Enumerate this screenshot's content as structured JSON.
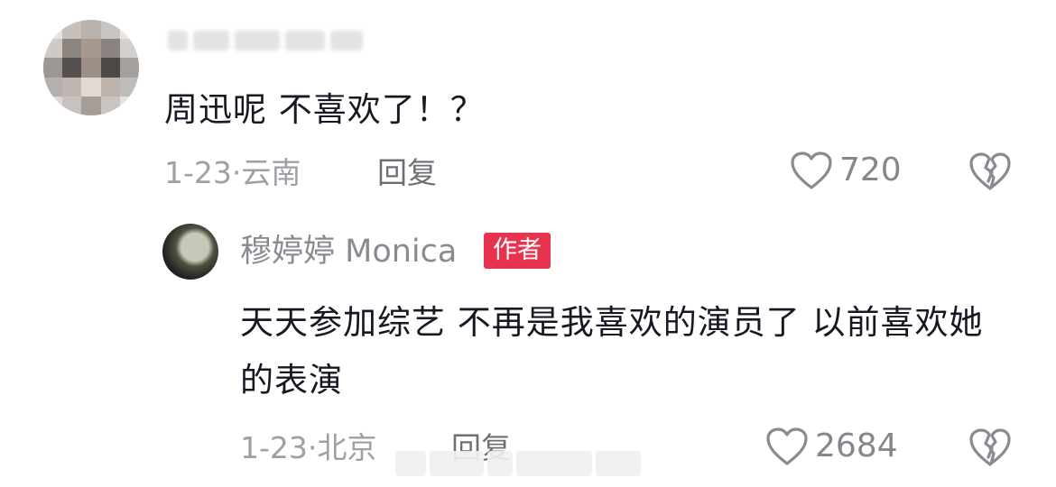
{
  "comments": [
    {
      "username": "",
      "text": "周迅呢 不喜欢了！？",
      "date": "1-23",
      "separator": "·",
      "location": "云南",
      "reply_label": "回复",
      "likes": "720"
    }
  ],
  "reply": {
    "username": "穆婷婷 Monica",
    "badge": "作者",
    "text": "天天参加综艺 不再是我喜欢的演员了 以前喜欢她的表演",
    "date": "1-23",
    "separator": "·",
    "location": "北京",
    "reply_label": "回复",
    "likes": "2684"
  },
  "icons": {
    "like": "heart-outline-icon",
    "dislike": "broken-heart-icon"
  },
  "colors": {
    "author_badge": "#e8334e",
    "meta_text": "#9fa0a6",
    "primary_text": "#161823"
  }
}
